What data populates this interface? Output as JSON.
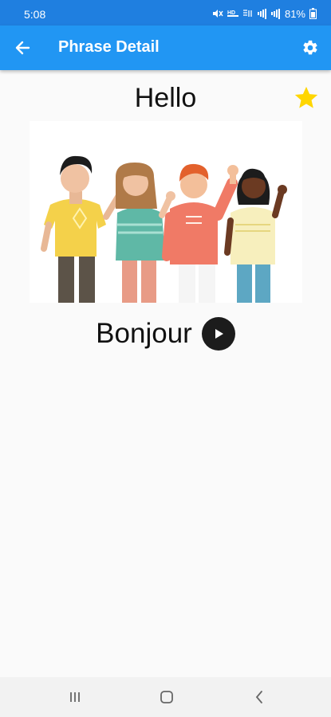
{
  "status_bar": {
    "time": "5:08",
    "battery": "81%",
    "icons": [
      "mute-icon",
      "hd-icon",
      "wifi-calling-icon",
      "signal-icon",
      "signal-icon",
      "battery-icon"
    ]
  },
  "app_bar": {
    "title": "Phrase Detail",
    "back_icon": "arrow-left-icon",
    "settings_icon": "gear-icon",
    "color": "#2196f3"
  },
  "phrase": {
    "english": "Hello",
    "translation": "Bonjour",
    "favorited": true,
    "favorite_color": "#ffd600"
  },
  "illustration": {
    "name": "people-waving-illustration"
  },
  "nav_bar": {
    "icons": [
      "recent-apps-icon",
      "home-icon",
      "back-icon"
    ]
  }
}
